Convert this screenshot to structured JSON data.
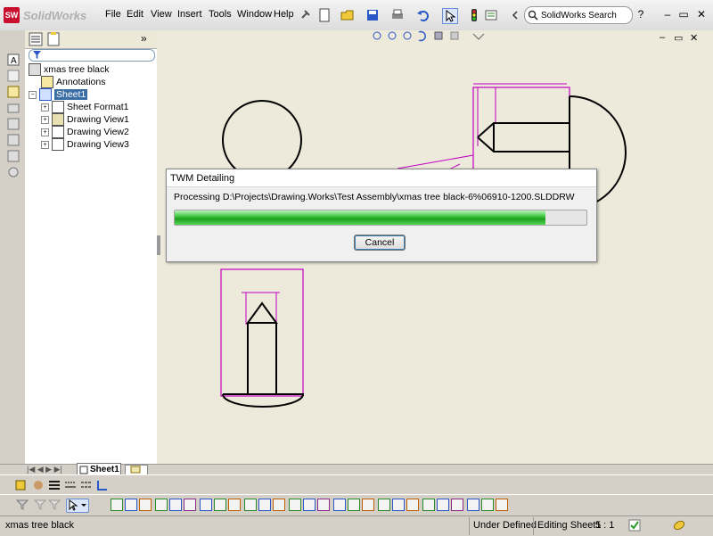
{
  "app": {
    "name": "SolidWorks",
    "logo_badge": "SW"
  },
  "menu": [
    "File",
    "Edit",
    "View",
    "Insert",
    "Tools",
    "Window",
    "Help"
  ],
  "search": {
    "label": "SolidWorks Search"
  },
  "window_controls": {
    "help": "?",
    "minimize": "–",
    "restore": "▭",
    "close": "✕"
  },
  "tree": {
    "root": "xmas tree black",
    "items": [
      {
        "label": "Annotations",
        "icon": "annotations-icon"
      },
      {
        "label": "Sheet1",
        "icon": "sheet-icon",
        "selected": true
      },
      {
        "label": "Sheet Format1",
        "icon": "sheet-format-icon"
      },
      {
        "label": "Drawing View1",
        "icon": "drawing-view-icon"
      },
      {
        "label": "Drawing View2",
        "icon": "drawing-view-icon"
      },
      {
        "label": "Drawing View3",
        "icon": "drawing-view-icon"
      }
    ]
  },
  "sheet_tab": {
    "label": "Sheet1"
  },
  "dialog": {
    "title": "TWM Detailing",
    "message": "Processing D:\\Projects\\Drawing.Works\\Test Assembly\\xmas tree black-6%06910-1200.SLDDRW",
    "progress": 0.9,
    "cancel_label": "Cancel"
  },
  "status": {
    "document": "xmas tree black",
    "state": "Under Defined",
    "editing": "Editing Sheet1",
    "scale": "5 : 1"
  },
  "colors": {
    "dimension": "#c000c0",
    "geometry": "#000000",
    "sheet_background": "#ede9db",
    "progress_green": "#2fb52f",
    "selected_highlight": "#3a6ea5"
  }
}
